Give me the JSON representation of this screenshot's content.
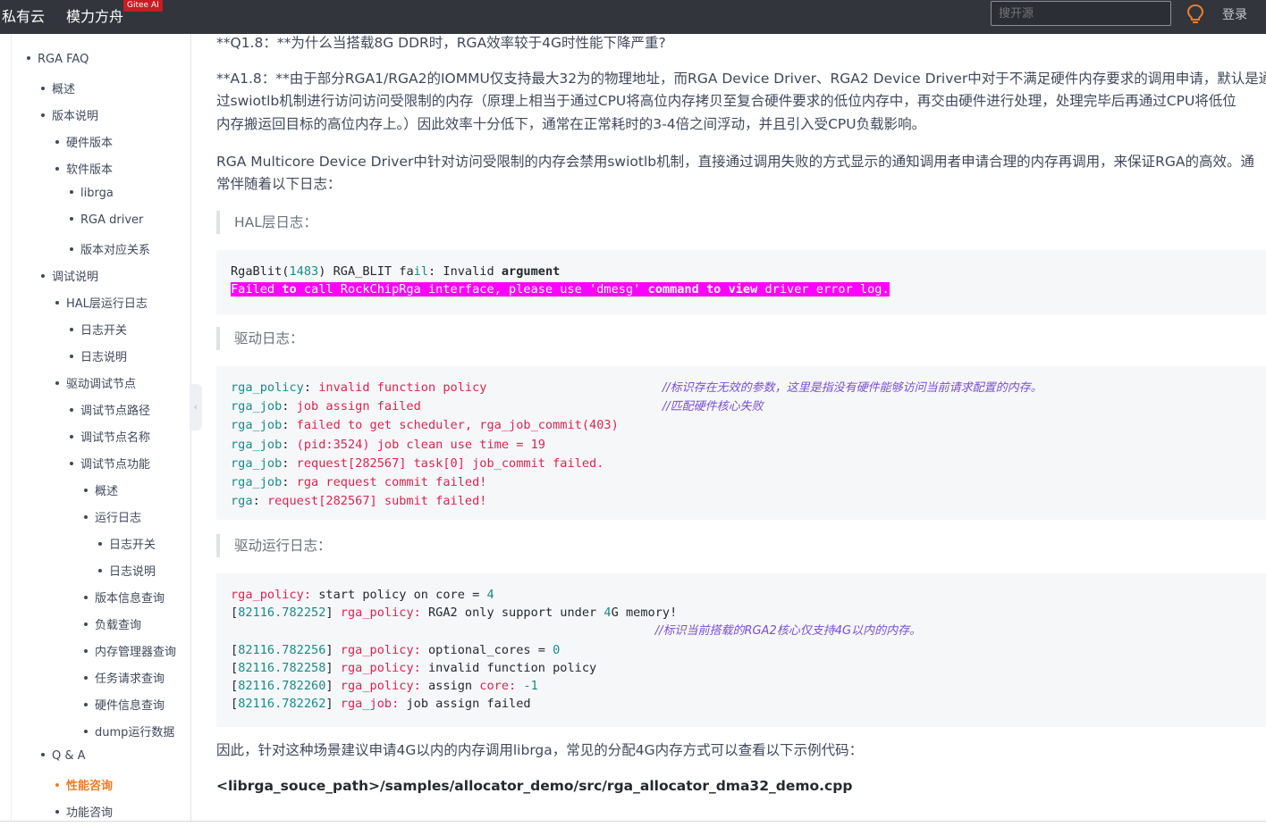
{
  "topbar": {
    "brand1": "私有云",
    "brand2": "模力方舟",
    "badge": "Gitee AI",
    "search_placeholder": "搜开源",
    "bulb_icon": "lightbulb-icon",
    "login": "登录"
  },
  "sidebar": {
    "items": [
      {
        "label": "RGA FAQ",
        "level": 0
      },
      {
        "label": "概述",
        "level": 1
      },
      {
        "label": "版本说明",
        "level": 1
      },
      {
        "label": "硬件版本",
        "level": 2
      },
      {
        "label": "软件版本",
        "level": 2
      },
      {
        "label": "librga",
        "level": 3
      },
      {
        "label": "RGA driver",
        "level": 3
      },
      {
        "label": "版本对应关系",
        "level": 3
      },
      {
        "label": "调试说明",
        "level": 1
      },
      {
        "label": "HAL层运行日志",
        "level": 2
      },
      {
        "label": "日志开关",
        "level": 3
      },
      {
        "label": "日志说明",
        "level": 3
      },
      {
        "label": "驱动调试节点",
        "level": 2
      },
      {
        "label": "调试节点路径",
        "level": 3
      },
      {
        "label": "调试节点名称",
        "level": 3
      },
      {
        "label": "调试节点功能",
        "level": 3
      },
      {
        "label": "概述",
        "level": 4
      },
      {
        "label": "运行日志",
        "level": 4
      },
      {
        "label": "日志开关",
        "level": 5
      },
      {
        "label": "日志说明",
        "level": 5
      },
      {
        "label": "版本信息查询",
        "level": 4
      },
      {
        "label": "负载查询",
        "level": 4
      },
      {
        "label": "内存管理器查询",
        "level": 4
      },
      {
        "label": "任务请求查询",
        "level": 4
      },
      {
        "label": "硬件信息查询",
        "level": 4
      },
      {
        "label": "dump运行数据",
        "level": 4
      },
      {
        "label": "Q & A",
        "level": 1
      },
      {
        "label": "性能咨询",
        "level": 2,
        "active": true
      },
      {
        "label": "功能咨询",
        "level": 2
      }
    ],
    "collapse_icon": "chevron-left-icon"
  },
  "content": {
    "q": "**Q1.8：**为什么当搭载8G DDR时，RGA效率较于4G时性能下降严重?",
    "a_line1": "**A1.8：**由于部分RGA1/RGA2的IOMMU仅支持最大32为的物理地址，而RGA Device Driver、RGA2 Device Driver中对于不满足硬件内存要求的调用申请，默认是通",
    "a_line2": "过swiotlb机制进行访问访问受限制的内存（原理上相当于通过CPU将高位内存拷贝至复合硬件要求的低位内存中，再交由硬件进行处理，处理完毕后再通过CPU将低位",
    "a_line3": "内存搬运回目标的高位内存上。）因此效率十分低下，通常在正常耗时的3-4倍之间浮动，并且引入受CPU负载影响。",
    "p2_line1": "RGA Multicore Device Driver中针对访问受限制的内存会禁用swiotlb机制，直接通过调用失败的方式显示的通知调用者申请合理的内存再调用，来保证RGA的高效。通",
    "p2_line2": "常伴随着以下日志：",
    "quote1": "HAL层日志：",
    "quote2": "驱动日志：",
    "quote3": "驱动运行日志：",
    "code1": {
      "l1_a": "RgaBlit(",
      "l1_num": "1483",
      "l1_b": ") RGA_BLIT fa",
      "l1_c": "il",
      "l1_d": ": Invalid ",
      "l1_e": "argument",
      "l2_a": "Failed ",
      "l2_b": "to",
      "l2_c": " call RockChipRga interface, please use 'dmesg' ",
      "l2_d": "command",
      "l2_e": " ",
      "l2_f": "to",
      "l2_g": " ",
      "l2_h": "view",
      "l2_i": " driver error log."
    },
    "code2": {
      "lines": [
        {
          "k": "rga_policy",
          "v": ": ",
          "r": "invalid function policy",
          "pad": "                        ",
          "c": "//标识存在无效的参数，这里是指没有硬件能够访问当前请求配置的内存。"
        },
        {
          "k": "rga_job",
          "v": ": ",
          "r": "job assign failed",
          "pad": "                                 ",
          "c": "//匹配硬件核心失败"
        },
        {
          "k": "rga_job",
          "v": ": ",
          "r": "failed to get scheduler, rga_job_commit(403)",
          "pad": "",
          "c": ""
        },
        {
          "k": "rga_job",
          "v": ": ",
          "r": "(pid:3524) job clean use time = 19",
          "pad": "",
          "c": ""
        },
        {
          "k": "rga_job",
          "v": ": ",
          "r": "request[282567] task[0] job_commit failed.",
          "pad": "",
          "c": ""
        },
        {
          "k": "rga_job",
          "v": ": ",
          "r": "rga request commit failed!",
          "pad": "",
          "c": ""
        },
        {
          "k": "rga",
          "v": ": ",
          "r": "request[282567] submit failed!",
          "pad": "",
          "c": ""
        }
      ]
    },
    "code3": {
      "l1_k": "rga_policy:",
      "l1_t": " start policy on core = ",
      "l1_n": "4",
      "l2_ts": "82116.782252",
      "l2_k": "rga_policy:",
      "l2_t1": " RGA2 only support under ",
      "l2_n": "4",
      "l2_t2": "G memory!",
      "l3_c": "//标识当前搭载的RGA2核心仅支持4G以内的内存。",
      "l4_ts": "82116.782256",
      "l4_k": "rga_policy:",
      "l4_t": " optional_cores = ",
      "l4_n": "0",
      "l5_ts": "82116.782258",
      "l5_k": "rga_policy:",
      "l5_t": " invalid function policy",
      "l6_ts": "82116.782260",
      "l6_k": "rga_policy:",
      "l6_t": " assign ",
      "l6_k2": "core:",
      "l6_n": " -1",
      "l7_ts": "82116.782262",
      "l7_k": "rga_job:",
      "l7_t": " job assign failed"
    },
    "p3": "因此，针对这种场景建议申请4G以内的内存调用librga，常见的分配4G内存方式可以查看以下示例代码：",
    "path": "<librga_souce_path>/samples/allocator_demo/src/rga_allocator_dma32_demo.cpp"
  }
}
